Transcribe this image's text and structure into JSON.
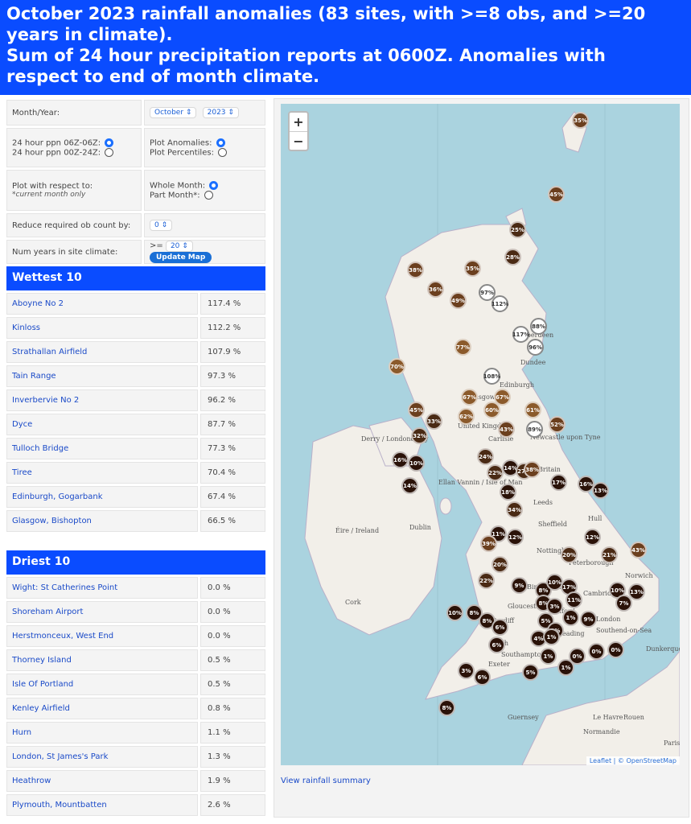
{
  "header": {
    "line1": "October 2023 rainfall anomalies (83 sites, with >=8 obs, and >=20",
    "line2": "years in climate).",
    "line3": "Sum of 24 hour precipitation reports at 0600Z. Anomalies with",
    "line4": "respect to end of month climate."
  },
  "controls": {
    "month_year_label": "Month/Year:",
    "month_value": "October",
    "year_value": "2023",
    "ppn_06": "24 hour ppn 06Z-06Z:",
    "ppn_00": "24 hour ppn 00Z-24Z:",
    "plot_anomalies": "Plot Anomalies:",
    "plot_percentiles": "Plot Percentiles:",
    "respect_label": "Plot with respect to:",
    "respect_note": "*current month only",
    "whole_month": "Whole Month:",
    "part_month": "Part Month*:",
    "reduce_label": "Reduce required ob count by:",
    "reduce_value": "0",
    "num_years_label": "Num years in site climate:",
    "num_years_op": ">=",
    "num_years_value": "20",
    "update_button": "Update Map"
  },
  "wettest": {
    "title": "Wettest 10",
    "rows": [
      {
        "name": "Aboyne No 2",
        "pct": "117.4 %"
      },
      {
        "name": "Kinloss",
        "pct": "112.2 %"
      },
      {
        "name": "Strathallan Airfield",
        "pct": "107.9 %"
      },
      {
        "name": "Tain Range",
        "pct": "97.3 %"
      },
      {
        "name": "Inverbervie No 2",
        "pct": "96.2 %"
      },
      {
        "name": "Dyce",
        "pct": "87.7 %"
      },
      {
        "name": "Tulloch Bridge",
        "pct": "77.3 %"
      },
      {
        "name": "Tiree",
        "pct": "70.4 %"
      },
      {
        "name": "Edinburgh, Gogarbank",
        "pct": "67.4 %"
      },
      {
        "name": "Glasgow, Bishopton",
        "pct": "66.5 %"
      }
    ]
  },
  "driest": {
    "title": "Driest 10",
    "rows": [
      {
        "name": "Wight: St Catherines Point",
        "pct": "0.0 %"
      },
      {
        "name": "Shoreham Airport",
        "pct": "0.0 %"
      },
      {
        "name": "Herstmonceux, West End",
        "pct": "0.0 %"
      },
      {
        "name": "Thorney Island",
        "pct": "0.5 %"
      },
      {
        "name": "Isle Of Portland",
        "pct": "0.5 %"
      },
      {
        "name": "Kenley Airfield",
        "pct": "0.8 %"
      },
      {
        "name": "Hurn",
        "pct": "1.1 %"
      },
      {
        "name": "London, St James's Park",
        "pct": "1.3 %"
      },
      {
        "name": "Heathrow",
        "pct": "1.9 %"
      },
      {
        "name": "Plymouth, Mountbatten",
        "pct": "2.6 %"
      }
    ]
  },
  "map": {
    "zoom_in": "+",
    "zoom_out": "−",
    "attribution_leaflet": "Leaflet",
    "attribution_sep": " | © ",
    "attribution_osm": "OpenStreetMap",
    "places": [
      "Aberdeen",
      "Dundee",
      "Edinburgh",
      "Glasgow",
      "United Kingdom",
      "Carlisle",
      "Newcastle upon Tyne",
      "Derry / Londonderry",
      "Britain",
      "Ellan Vannin / Isle of Man",
      "Leeds",
      "Hull",
      "Sheffield",
      "Éire / Ireland",
      "Dublin",
      "Nottingham",
      "Peterborough",
      "Norwich",
      "Birmingham",
      "Cambridge",
      "Cork",
      "Gloucester",
      "Oxford",
      "London",
      "Cardiff",
      "Bath",
      "Reading",
      "Southend-on-Sea",
      "Southampton",
      "Exeter",
      "Dunkerque",
      "Guernsey",
      "Le Havre",
      "Rouen",
      "Normandie",
      "Paris"
    ],
    "markers": [
      "35%",
      "45%",
      "25%",
      "28%",
      "38%",
      "35%",
      "36%",
      "49%",
      "97%",
      "112%",
      "88%",
      "117%",
      "96%",
      "77%",
      "70%",
      "108%",
      "67%",
      "67%",
      "60%",
      "62%",
      "61%",
      "45%",
      "33%",
      "43%",
      "89%",
      "52%",
      "32%",
      "16%",
      "10%",
      "14%",
      "24%",
      "22%",
      "14%",
      "27%",
      "38%",
      "17%",
      "16%",
      "13%",
      "18%",
      "34%",
      "11%",
      "12%",
      "39%",
      "20%",
      "20%",
      "12%",
      "21%",
      "43%",
      "22%",
      "9%",
      "8%",
      "10%",
      "17%",
      "10%",
      "8%",
      "3%",
      "11%",
      "7%",
      "13%",
      "10%",
      "8%",
      "8%",
      "6%",
      "5%",
      "2%",
      "1%",
      "9%",
      "6%",
      "4%",
      "1%",
      "1%",
      "0%",
      "0%",
      "0%",
      "1%",
      "5%",
      "3%",
      "6%",
      "8%"
    ]
  },
  "summary_link": "View rainfall summary"
}
